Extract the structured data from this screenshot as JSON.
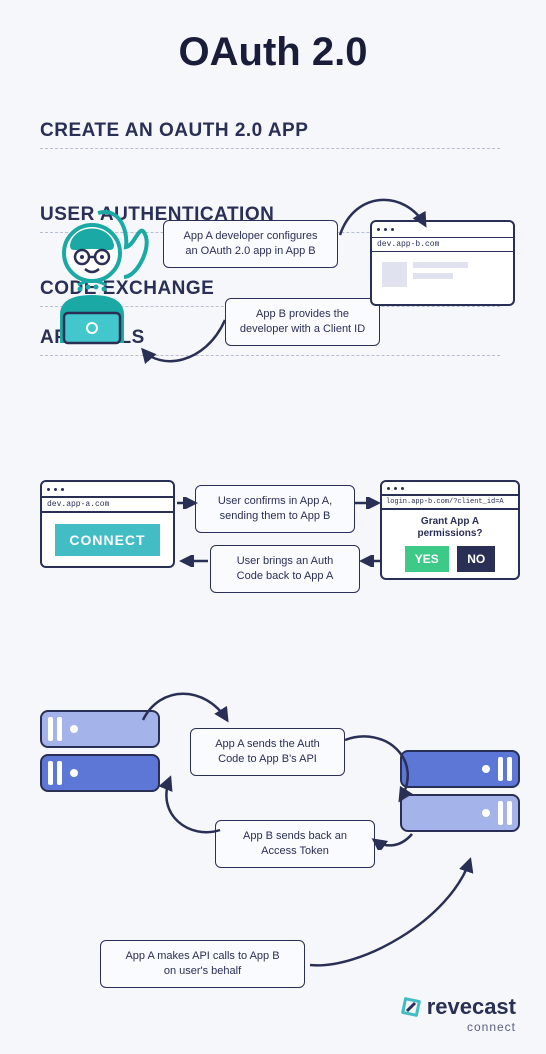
{
  "title": "OAuth 2.0",
  "sections": {
    "create": {
      "heading": "CREATE AN OAUTH 2.0 APP",
      "step_a": "App A developer configures\nan OAuth 2.0 app in App B",
      "step_b": "App B provides the\ndeveloper with a Client ID",
      "browser_b_url": "dev.app-b.com"
    },
    "auth": {
      "heading": "USER AUTHENTICATION",
      "step_a": "User confirms in App A,\nsending them to App B",
      "step_b": "User brings an Auth\nCode back to App A",
      "browser_a_url": "dev.app-a.com",
      "connect_label": "CONNECT",
      "login_url": "login.app-b.com/?client_id=A",
      "grant_question": "Grant App A\npermissions?",
      "yes": "YES",
      "no": "NO"
    },
    "code": {
      "heading": "CODE EXCHANGE",
      "step_a": "App A sends the Auth\nCode to App B's API",
      "step_b": "App B sends back an\nAccess Token"
    },
    "api": {
      "heading": "API CALLS",
      "step_a": "App A makes API calls to App B\non user's behalf"
    }
  },
  "brand": {
    "name": "revecast",
    "sub": "connect"
  },
  "colors": {
    "navy": "#2a2f55",
    "teal": "#42bdc4",
    "green": "#3dca89",
    "blue_light": "#a4b4ea",
    "blue_dark": "#5d77d7"
  }
}
